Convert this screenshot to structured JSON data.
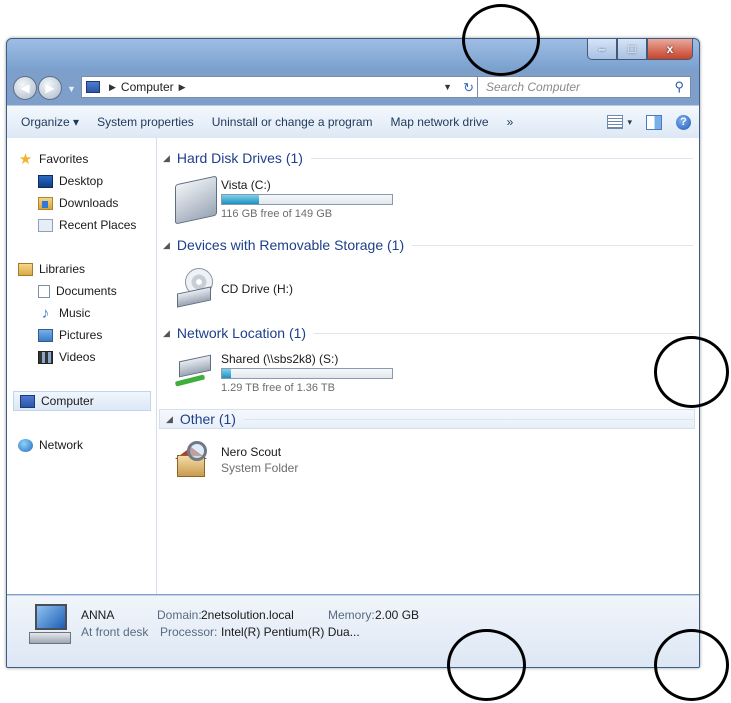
{
  "window": {
    "buttons": {
      "minimize": "–",
      "maximize": "□",
      "close": "x"
    }
  },
  "address": {
    "back_glyph": "◀",
    "forward_glyph": "▶",
    "breadcrumb": "Computer",
    "search_placeholder": "Search Computer"
  },
  "toolbar": {
    "organize": "Organize ▾",
    "system_properties": "System properties",
    "uninstall": "Uninstall or change a program",
    "map_network_drive": "Map network drive",
    "more": "»",
    "views_dropdown": "▾",
    "help": "?"
  },
  "nav": {
    "favorites": {
      "label": "Favorites",
      "icon": "star-icon"
    },
    "favorites_items": [
      {
        "label": "Desktop",
        "icon": "desktop-icon"
      },
      {
        "label": "Downloads",
        "icon": "downloads-folder-icon"
      },
      {
        "label": "Recent Places",
        "icon": "recent-places-icon"
      }
    ],
    "libraries": {
      "label": "Libraries",
      "icon": "libraries-icon"
    },
    "libraries_items": [
      {
        "label": "Documents",
        "icon": "documents-icon"
      },
      {
        "label": "Music",
        "icon": "music-note-icon"
      },
      {
        "label": "Pictures",
        "icon": "pictures-icon"
      },
      {
        "label": "Videos",
        "icon": "videos-icon"
      }
    ],
    "computer": {
      "label": "Computer",
      "icon": "computer-icon"
    },
    "network": {
      "label": "Network",
      "icon": "network-icon"
    }
  },
  "groups": [
    {
      "header": "Hard Disk Drives (1)"
    },
    {
      "header": "Devices with Removable Storage (1)"
    },
    {
      "header": "Network Location (1)"
    },
    {
      "header": "Other (1)"
    }
  ],
  "drives": {
    "vista": {
      "name": "Vista (C:)",
      "free": "116 GB free of 149 GB",
      "used_fraction": 0.22
    },
    "cd": {
      "name": "CD Drive (H:)"
    },
    "shared": {
      "name": "Shared (\\\\sbs2k8) (S:)",
      "free": "1.29 TB free of 1.36 TB",
      "used_fraction": 0.05
    }
  },
  "other": {
    "name": "Nero Scout",
    "sub": "System Folder"
  },
  "details": {
    "computer_name": "ANNA",
    "description": "At front desk",
    "domain_label": "Domain:",
    "domain_value": "2netsolution.local",
    "memory_label": "Memory:",
    "memory_value": "2.00 GB",
    "processor_label": "Processor:",
    "processor_value": "Intel(R) Pentium(R) Dua..."
  },
  "colors": {
    "accent": "#1e3f8a",
    "frame": "#7d9fc9",
    "bar_fill": "#1f8fbf"
  }
}
